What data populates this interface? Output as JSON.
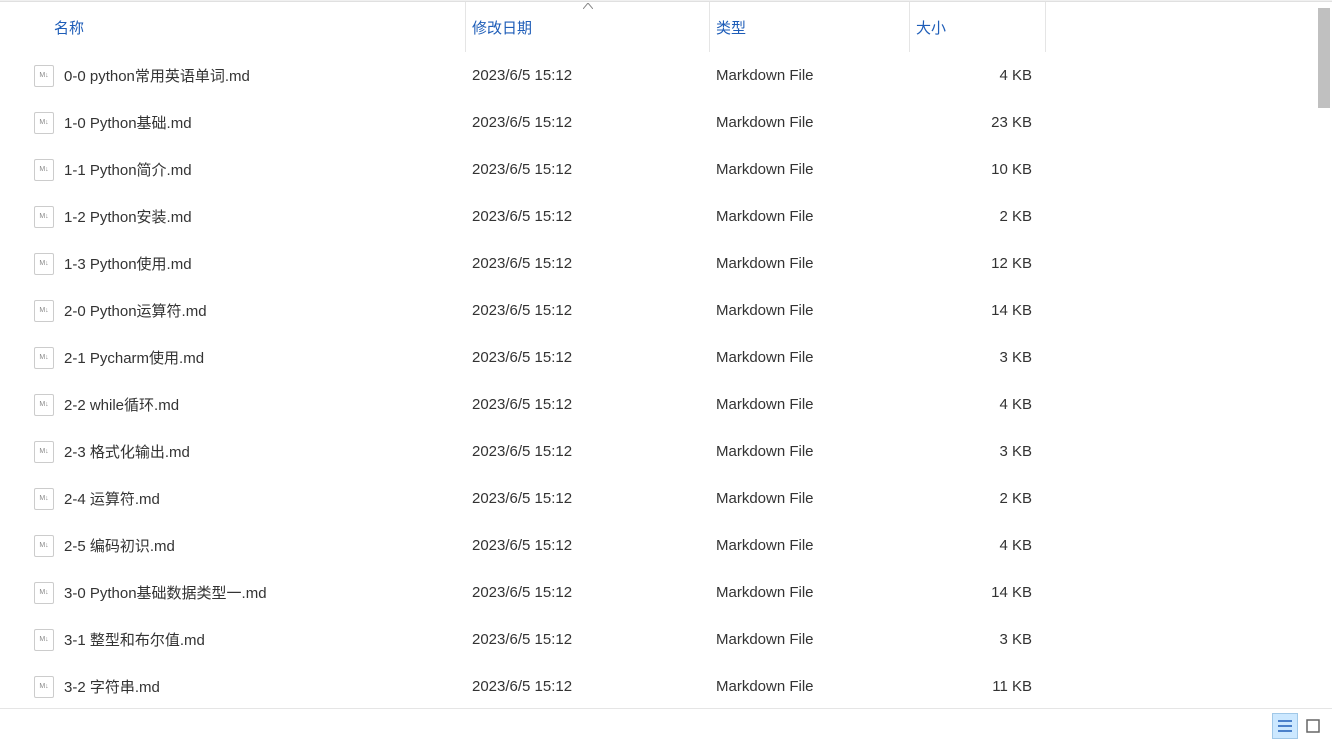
{
  "columns": {
    "name": "名称",
    "date": "修改日期",
    "type": "类型",
    "size": "大小"
  },
  "sort_column": "date",
  "sort_direction": "asc",
  "files": [
    {
      "name": "0-0 python常用英语单词.md",
      "date": "2023/6/5 15:12",
      "type": "Markdown File",
      "size": "4 KB"
    },
    {
      "name": "1-0 Python基础.md",
      "date": "2023/6/5 15:12",
      "type": "Markdown File",
      "size": "23 KB"
    },
    {
      "name": "1-1 Python简介.md",
      "date": "2023/6/5 15:12",
      "type": "Markdown File",
      "size": "10 KB"
    },
    {
      "name": "1-2 Python安装.md",
      "date": "2023/6/5 15:12",
      "type": "Markdown File",
      "size": "2 KB"
    },
    {
      "name": "1-3 Python使用.md",
      "date": "2023/6/5 15:12",
      "type": "Markdown File",
      "size": "12 KB"
    },
    {
      "name": "2-0 Python运算符.md",
      "date": "2023/6/5 15:12",
      "type": "Markdown File",
      "size": "14 KB"
    },
    {
      "name": "2-1 Pycharm使用.md",
      "date": "2023/6/5 15:12",
      "type": "Markdown File",
      "size": "3 KB"
    },
    {
      "name": "2-2 while循环.md",
      "date": "2023/6/5 15:12",
      "type": "Markdown File",
      "size": "4 KB"
    },
    {
      "name": "2-3 格式化输出.md",
      "date": "2023/6/5 15:12",
      "type": "Markdown File",
      "size": "3 KB"
    },
    {
      "name": "2-4 运算符.md",
      "date": "2023/6/5 15:12",
      "type": "Markdown File",
      "size": "2 KB"
    },
    {
      "name": "2-5 编码初识.md",
      "date": "2023/6/5 15:12",
      "type": "Markdown File",
      "size": "4 KB"
    },
    {
      "name": "3-0 Python基础数据类型一.md",
      "date": "2023/6/5 15:12",
      "type": "Markdown File",
      "size": "14 KB"
    },
    {
      "name": "3-1 整型和布尔值.md",
      "date": "2023/6/5 15:12",
      "type": "Markdown File",
      "size": "3 KB"
    },
    {
      "name": "3-2 字符串.md",
      "date": "2023/6/5 15:12",
      "type": "Markdown File",
      "size": "11 KB"
    }
  ]
}
